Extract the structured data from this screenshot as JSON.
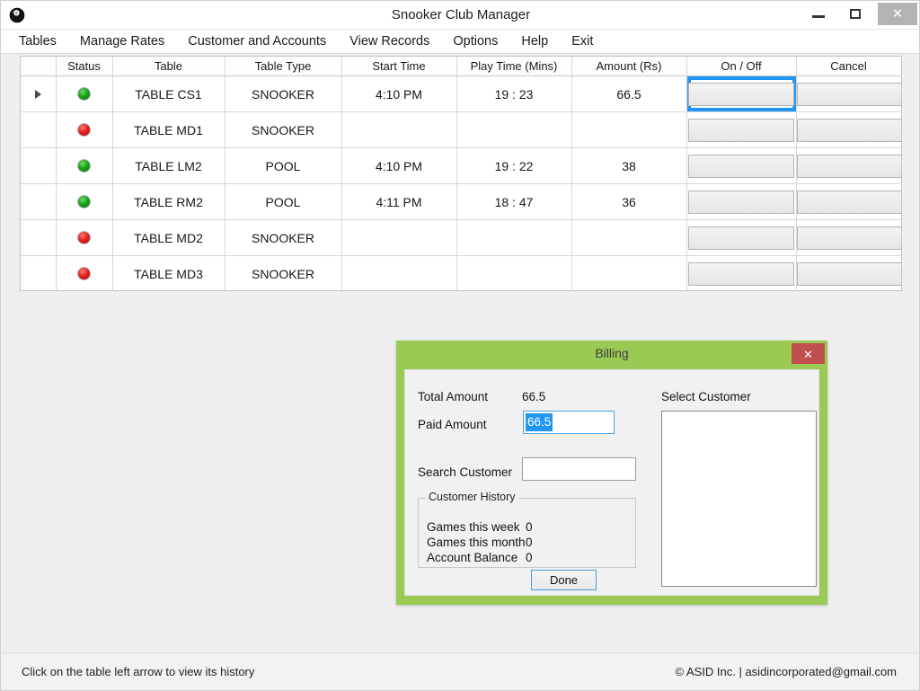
{
  "window": {
    "title": "Snooker Club Manager",
    "icon": "eight-ball-icon",
    "controls": {
      "minimize": "–",
      "maximize": "□",
      "close": "✕"
    }
  },
  "menu": {
    "items": [
      {
        "label": "Tables"
      },
      {
        "label": "Manage Rates"
      },
      {
        "label": "Customer and Accounts"
      },
      {
        "label": "View Records"
      },
      {
        "label": "Options"
      },
      {
        "label": "Help"
      },
      {
        "label": "Exit"
      }
    ]
  },
  "grid": {
    "columns": [
      "",
      "Status",
      "Table",
      "Table Type",
      "Start Time",
      "Play Time (Mins)",
      "Amount (Rs)",
      "On / Off",
      "Cancel"
    ],
    "rows": [
      {
        "selected": true,
        "status": "on",
        "table": "TABLE CS1",
        "table_type": "SNOOKER",
        "start_time": "4:10 PM",
        "play_time": "19 : 23",
        "amount": "66.5",
        "on_off": "",
        "cancel": "",
        "on_off_focused": true
      },
      {
        "selected": false,
        "status": "off",
        "table": "TABLE MD1",
        "table_type": "SNOOKER",
        "start_time": "",
        "play_time": "",
        "amount": "",
        "on_off": "",
        "cancel": "",
        "on_off_focused": false
      },
      {
        "selected": false,
        "status": "on",
        "table": "TABLE LM2",
        "table_type": "POOL",
        "start_time": "4:10 PM",
        "play_time": "19 : 22",
        "amount": "38",
        "on_off": "",
        "cancel": "",
        "on_off_focused": false
      },
      {
        "selected": false,
        "status": "on",
        "table": "TABLE RM2",
        "table_type": "POOL",
        "start_time": "4:11 PM",
        "play_time": "18 : 47",
        "amount": "36",
        "on_off": "",
        "cancel": "",
        "on_off_focused": false
      },
      {
        "selected": false,
        "status": "off",
        "table": "TABLE MD2",
        "table_type": "SNOOKER",
        "start_time": "",
        "play_time": "",
        "amount": "",
        "on_off": "",
        "cancel": "",
        "on_off_focused": false
      },
      {
        "selected": false,
        "status": "off",
        "table": "TABLE MD3",
        "table_type": "SNOOKER",
        "start_time": "",
        "play_time": "",
        "amount": "",
        "on_off": "",
        "cancel": "",
        "on_off_focused": false
      }
    ]
  },
  "billing_dialog": {
    "title": "Billing",
    "close_glyph": "✕",
    "total_amount_label": "Total Amount",
    "total_amount_value": "66.5",
    "paid_amount_label": "Paid Amount",
    "paid_amount_value": "66.5",
    "search_customer_label": "Search Customer",
    "search_customer_value": "",
    "customer_history": {
      "legend": "Customer History",
      "games_week_label": "Games this week",
      "games_week_value": "0",
      "games_month_label": "Games this month",
      "games_month_value": "0",
      "account_balance_label": "Account Balance",
      "account_balance_value": "0"
    },
    "done_label": "Done",
    "select_customer_label": "Select Customer",
    "customer_list": []
  },
  "status_bar": {
    "hint": "Click on the table left arrow to view its history",
    "credit": "© ASID Inc.  |  asidincorporated@gmail.com"
  },
  "colors": {
    "dialog_green": "#9aca54",
    "dialog_close_red": "#c0504d",
    "focus_blue": "#2196f3",
    "status_on": "#18a018",
    "status_off": "#e02020",
    "window_bg": "#efefef"
  }
}
